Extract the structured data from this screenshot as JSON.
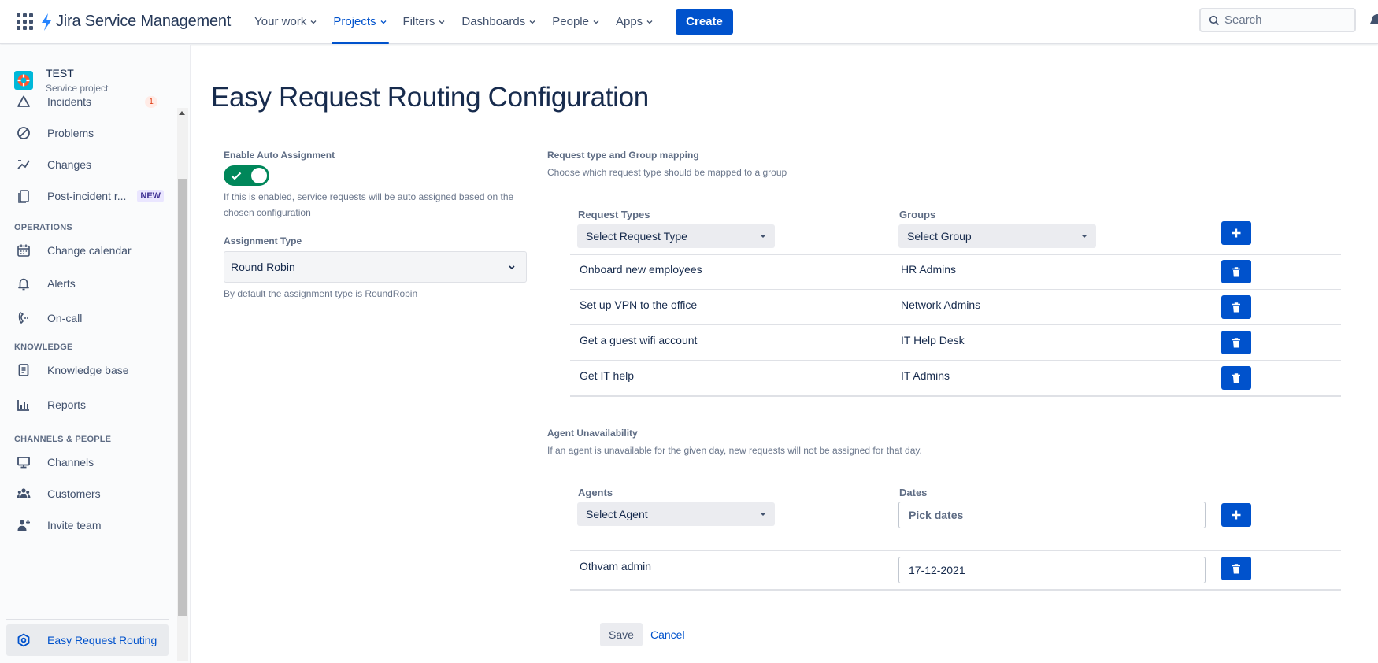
{
  "nav": {
    "product_name": "Jira Service Management",
    "items": [
      {
        "label": "Your work"
      },
      {
        "label": "Projects"
      },
      {
        "label": "Filters"
      },
      {
        "label": "Dashboards"
      },
      {
        "label": "People"
      },
      {
        "label": "Apps"
      }
    ],
    "active_item": "Projects",
    "create_label": "Create",
    "search_placeholder": "Search"
  },
  "sidebar": {
    "project_name": "TEST",
    "project_type": "Service project",
    "items": [
      {
        "label": "Incidents",
        "icon": "warning-triangle-icon",
        "badge": "1"
      },
      {
        "label": "Problems",
        "icon": "problem-circle-icon"
      },
      {
        "label": "Changes",
        "icon": "changes-icon"
      },
      {
        "label": "Post-incident r...",
        "icon": "post-incident-review-icon",
        "badge_new": "NEW"
      },
      {
        "label": "Change calendar",
        "icon": "calendar-icon"
      },
      {
        "label": "Alerts",
        "icon": "bell-icon"
      },
      {
        "label": "On-call",
        "icon": "on-call-phone-icon"
      },
      {
        "label": "Knowledge base",
        "icon": "book-icon"
      },
      {
        "label": "Reports",
        "icon": "reports-bar-chart-icon"
      },
      {
        "label": "Channels",
        "icon": "monitor-icon"
      },
      {
        "label": "Customers",
        "icon": "people-icon"
      },
      {
        "label": "Invite team",
        "icon": "add-person-icon"
      },
      {
        "label": "Easy Request Routing",
        "icon": "routing-hexagon-icon",
        "selected": true
      }
    ],
    "headings": [
      "OPERATIONS",
      "KNOWLEDGE",
      "CHANNELS & PEOPLE"
    ]
  },
  "page": {
    "title": "Easy Request Routing Configuration",
    "auto_assign": {
      "label": "Enable Auto Assignment",
      "enabled": true,
      "help": "If this is enabled, service requests will be auto assigned based on the chosen configuration"
    },
    "assignment_type": {
      "label": "Assignment Type",
      "value": "Round Robin",
      "help": "By default the assignment type is RoundRobin"
    },
    "mapping": {
      "title": "Request type and Group mapping",
      "subtitle": "Choose which request type should be mapped to a group",
      "col_request_types": "Request Types",
      "col_groups": "Groups",
      "select_request_type": "Select Request Type",
      "select_group": "Select Group",
      "rows": [
        {
          "request_type": "Onboard new employees",
          "group": "HR Admins"
        },
        {
          "request_type": "Set up VPN to the office",
          "group": "Network Admins"
        },
        {
          "request_type": "Get a guest wifi account",
          "group": "IT Help Desk"
        },
        {
          "request_type": "Get IT help",
          "group": "IT Admins"
        }
      ]
    },
    "unavailability": {
      "title": "Agent Unavailability",
      "subtitle": "If an agent is unavailable for the given day, new requests will not be assigned for that day.",
      "col_agents": "Agents",
      "col_dates": "Dates",
      "select_agent": "Select Agent",
      "dates_placeholder": "Pick dates",
      "rows": [
        {
          "agent": "Othvam admin",
          "date": "17-12-2021"
        }
      ]
    },
    "save_label": "Save",
    "cancel_label": "Cancel"
  },
  "colors": {
    "brand_blue": "#0052cc",
    "toggle_green": "#00875a",
    "badge_red": "#de350b"
  }
}
